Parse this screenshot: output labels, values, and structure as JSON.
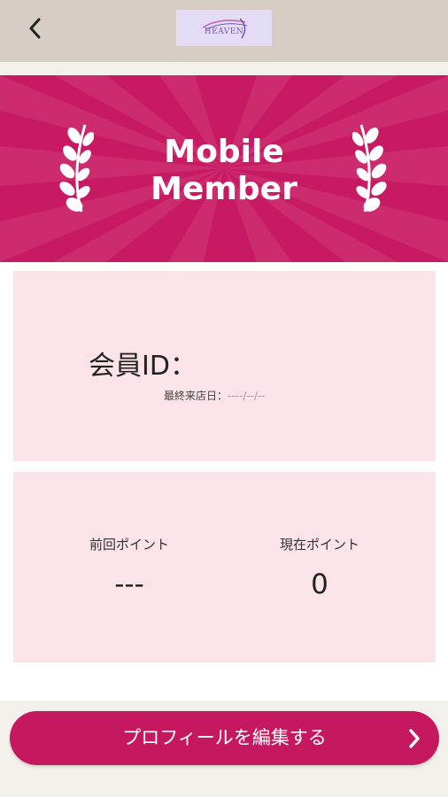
{
  "header": {
    "back_icon": "chevron-left-icon",
    "logo_text": "HEAVEN"
  },
  "banner": {
    "title_line1": "Mobile",
    "title_line2": "Member",
    "laurel_icon": "laurel-branch-icon",
    "colors": {
      "background": "#c81a62",
      "ray": "#d03a78",
      "text": "#ffffff"
    }
  },
  "member_card": {
    "id_label": "会員ID：",
    "last_visit_label": "最終来店日：",
    "last_visit_value": "----/--/--"
  },
  "points_card": {
    "previous_label": "前回ポイント",
    "previous_value": "---",
    "current_label": "現在ポイント",
    "current_value": "0"
  },
  "footer": {
    "edit_profile_label": "プロフィールを編集する",
    "chevron_icon": "chevron-right-icon"
  },
  "colors": {
    "accent": "#c5185f",
    "card_background": "#fbe3ea",
    "header_background": "#d6cdc4"
  }
}
